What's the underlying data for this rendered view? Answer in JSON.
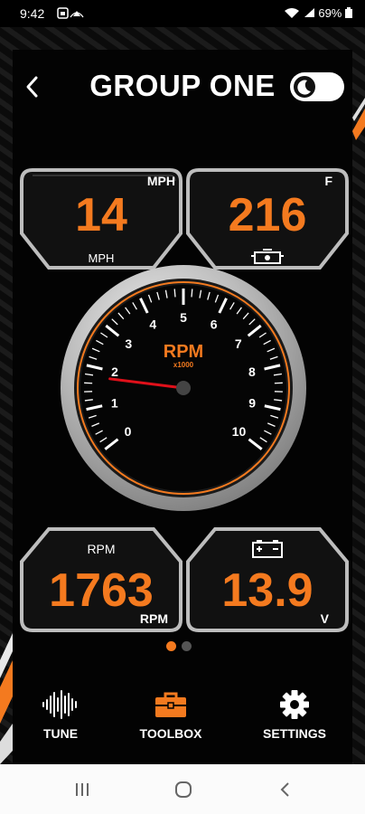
{
  "status": {
    "time": "9:42",
    "battery": "69%"
  },
  "topbar": {
    "title": "GROUP ONE"
  },
  "speed_gauge": {
    "value": "14",
    "unit_top": "MPH",
    "unit_bottom": "MPH"
  },
  "temp_gauge": {
    "value": "216",
    "unit": "F"
  },
  "tach": {
    "label": "RPM",
    "multiplier": "x1000",
    "ticks": [
      "0",
      "1",
      "2",
      "3",
      "4",
      "5",
      "6",
      "7",
      "8",
      "9",
      "10"
    ],
    "needle_value": 1.763
  },
  "rpm_gauge": {
    "label": "RPM",
    "value": "1763",
    "unit": "RPM"
  },
  "volt_gauge": {
    "value": "13.9",
    "unit": "V"
  },
  "page_dots": {
    "count": 2,
    "active_index": 0
  },
  "nav": {
    "tune": "TUNE",
    "toolbox": "TOOLBOX",
    "settings": "SETTINGS"
  },
  "colors": {
    "accent": "#f47a1f",
    "needle": "#e0101a",
    "bezel": "#c8c8c8"
  }
}
